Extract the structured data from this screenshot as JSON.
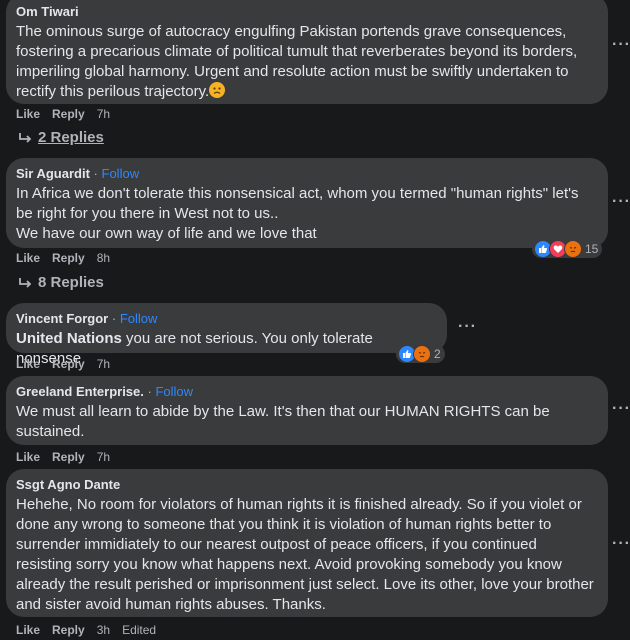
{
  "comments": [
    {
      "author": "Om Tiwari",
      "follow": "",
      "text_lines": [
        "The ominous surge of autocracy engulfing Pakistan portends grave consequences,",
        "fostering a precarious climate of political tumult that reverberates beyond its borders,",
        "imperiling global harmony. Urgent and resolute action must be swiftly undertaken to",
        "rectify this perilous trajectory."
      ],
      "emoji": "frowning-face",
      "like": "Like",
      "reply": "Reply",
      "time": "7h",
      "replies": "2 Replies"
    },
    {
      "author": "Sir Aguardit",
      "follow": "Follow",
      "text_lines": [
        "In Africa we don't tolerate this nonsensical act, whom you termed \"human rights\" let's",
        "be right for you there in West not to us..",
        "We have our own way of life and we love that"
      ],
      "reaction_count": "15",
      "reactions": [
        "like",
        "love",
        "angry"
      ],
      "like": "Like",
      "reply": "Reply",
      "time": "8h",
      "replies": "8 Replies"
    },
    {
      "author": "Vincent Forgor",
      "follow": "Follow",
      "bold_lead": "United Nations",
      "text": " you are not serious. You only tolerate nonsense",
      "reaction_count": "2",
      "reactions": [
        "like",
        "angry"
      ],
      "like": "Like",
      "reply": "Reply",
      "time": "7h"
    },
    {
      "author": "Greeland Enterprise.",
      "follow": "Follow",
      "text_lines": [
        "We must all learn to abide by the Law. It's then that our HUMAN RIGHTS can be",
        "sustained."
      ],
      "like": "Like",
      "reply": "Reply",
      "time": "7h"
    },
    {
      "author": "Ssgt Agno Dante",
      "follow": "",
      "text_lines": [
        "Hehehe, No room for violators of human rights it is finished already. So if you violet or",
        "done any wrong to someone that you think it is violation of human rights better to",
        "surrender immidiately to our nearest outpost of peace officers, if you continued",
        "resisting sorry you know what happens next. Avoid provoking somebody you know",
        "already the result perished or imprisonment just select. Love its other, love your brother",
        "and sister avoid human rights abuses. Thanks."
      ],
      "like": "Like",
      "reply": "Reply",
      "time": "3h",
      "edited": "Edited"
    }
  ],
  "dot": "·",
  "more": "···",
  "colors": {
    "background": "#18191a",
    "bubble": "#3a3b3c",
    "link": "#2d88ff",
    "text": "#e4e6eb",
    "muted": "#b0b3b8"
  }
}
